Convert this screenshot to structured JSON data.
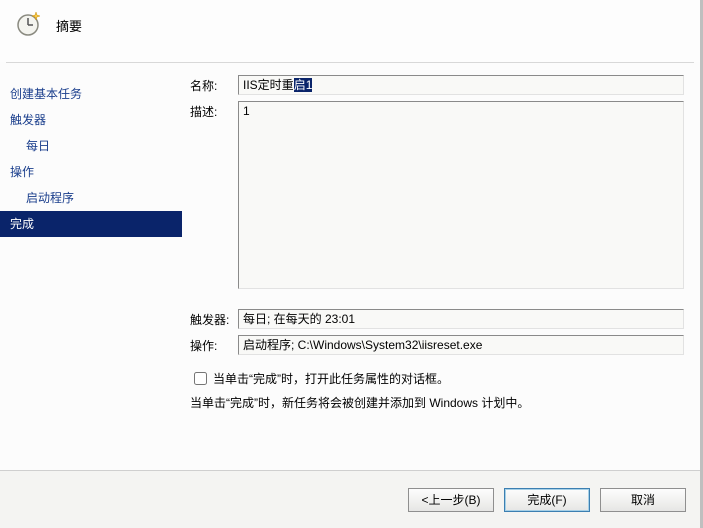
{
  "header": {
    "title": "摘要",
    "icon": "clock-new-icon"
  },
  "sidebar": {
    "items": [
      {
        "label": "创建基本任务",
        "indent": false,
        "selected": false
      },
      {
        "label": "触发器",
        "indent": false,
        "selected": false
      },
      {
        "label": "每日",
        "indent": true,
        "selected": false
      },
      {
        "label": "操作",
        "indent": false,
        "selected": false
      },
      {
        "label": "启动程序",
        "indent": true,
        "selected": false
      },
      {
        "label": "完成",
        "indent": false,
        "selected": true
      }
    ]
  },
  "summary": {
    "name_label": "名称:",
    "name_value_plain": "IIS定时重",
    "name_value_selected": "启1",
    "desc_label": "描述:",
    "desc_value": "1",
    "trigger_label": "触发器:",
    "trigger_value": "每日; 在每天的 23:01",
    "action_label": "操作:",
    "action_value": "启动程序; C:\\Windows\\System32\\iisreset.exe",
    "open_props_checked": false,
    "open_props_label": "当单击“完成”时，打开此任务属性的对话框。",
    "note": "当单击“完成”时，新任务将会被创建并添加到 Windows 计划中。"
  },
  "footer": {
    "back": "<上一步(B)",
    "finish": "完成(F)",
    "cancel": "取消"
  }
}
